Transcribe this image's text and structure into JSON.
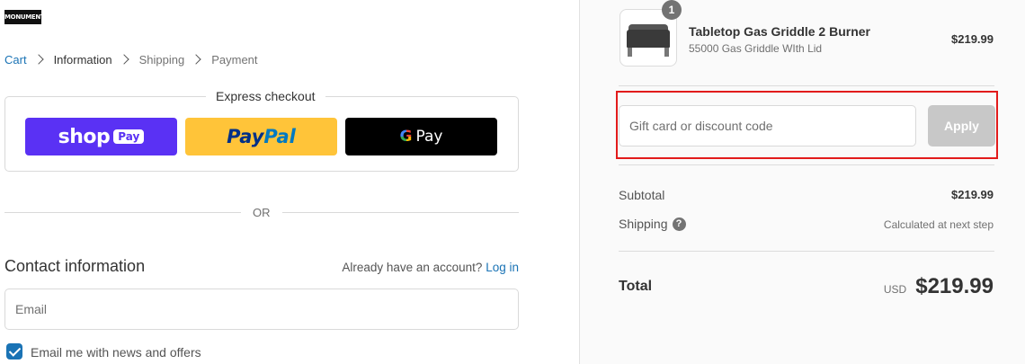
{
  "logo": {
    "text": "MONUMENT"
  },
  "breadcrumb": {
    "items": [
      {
        "label": "Cart"
      },
      {
        "label": "Information"
      },
      {
        "label": "Shipping"
      },
      {
        "label": "Payment"
      }
    ]
  },
  "express": {
    "title": "Express checkout",
    "shop_pay": {
      "word": "shop",
      "badge": "Pay",
      "color": "#5a31f4"
    },
    "paypal": {
      "part1": "Pay",
      "part2": "Pal",
      "color": "#ffc439"
    },
    "gpay": {
      "g": "G",
      "pay": "Pay",
      "color": "#000000"
    }
  },
  "divider_text": "OR",
  "contact": {
    "title": "Contact information",
    "account_prompt": "Already have an account?",
    "login_label": "Log in",
    "email_placeholder": "Email",
    "newsletter_label": "Email me with news and offers",
    "newsletter_checked": true
  },
  "order": {
    "item": {
      "name": "Tabletop Gas Griddle 2 Burner",
      "variant": "55000 Gas Griddle WIth Lid",
      "price": "$219.99",
      "quantity": "1",
      "icon": "griddle-image"
    },
    "discount": {
      "placeholder": "Gift card or discount code",
      "apply_label": "Apply"
    },
    "subtotal": {
      "label": "Subtotal",
      "value": "$219.99"
    },
    "shipping": {
      "label": "Shipping",
      "help": "?",
      "value": "Calculated at next step"
    },
    "total": {
      "label": "Total",
      "currency": "USD",
      "value": "$219.99"
    }
  },
  "colors": {
    "link": "#1a73b5",
    "highlight": "#e21b1b"
  }
}
